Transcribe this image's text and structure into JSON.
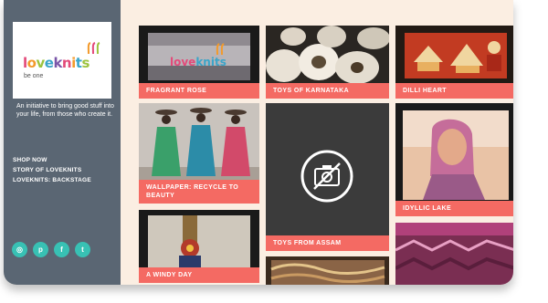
{
  "sidebar": {
    "logo": {
      "word": "loveknits",
      "tm": "TM",
      "sub": "be one"
    },
    "tagline": "An initiative to bring good stuff into your life, from those who create it.",
    "nav": [
      {
        "label": "SHOP NOW"
      },
      {
        "label": "STORY OF LOVEKNITS"
      },
      {
        "label": "LOVEKNITS: BACKSTAGE"
      }
    ],
    "social": [
      {
        "icon": "instagram-icon",
        "glyph": "◎"
      },
      {
        "icon": "pinterest-icon",
        "glyph": "p"
      },
      {
        "icon": "facebook-icon",
        "glyph": "f"
      },
      {
        "icon": "twitter-icon",
        "glyph": "t"
      }
    ]
  },
  "tiles": [
    {
      "caption": "FRAGRANT ROSE"
    },
    {
      "caption": "TOYS OF KARNATAKA"
    },
    {
      "caption": "DILLI HEART"
    },
    {
      "caption": "WALLPAPER: RECYCLE TO BEAUTY"
    },
    {
      "caption": "TOYS FROM ASSAM"
    },
    {
      "caption": "IDYLLIC LAKE"
    },
    {
      "caption": "A WINDY DAY"
    }
  ],
  "colors": {
    "sidebar": "#5a6673",
    "caption": "#f46a63",
    "social": "#38c1b4",
    "background": "#fbeee2"
  }
}
